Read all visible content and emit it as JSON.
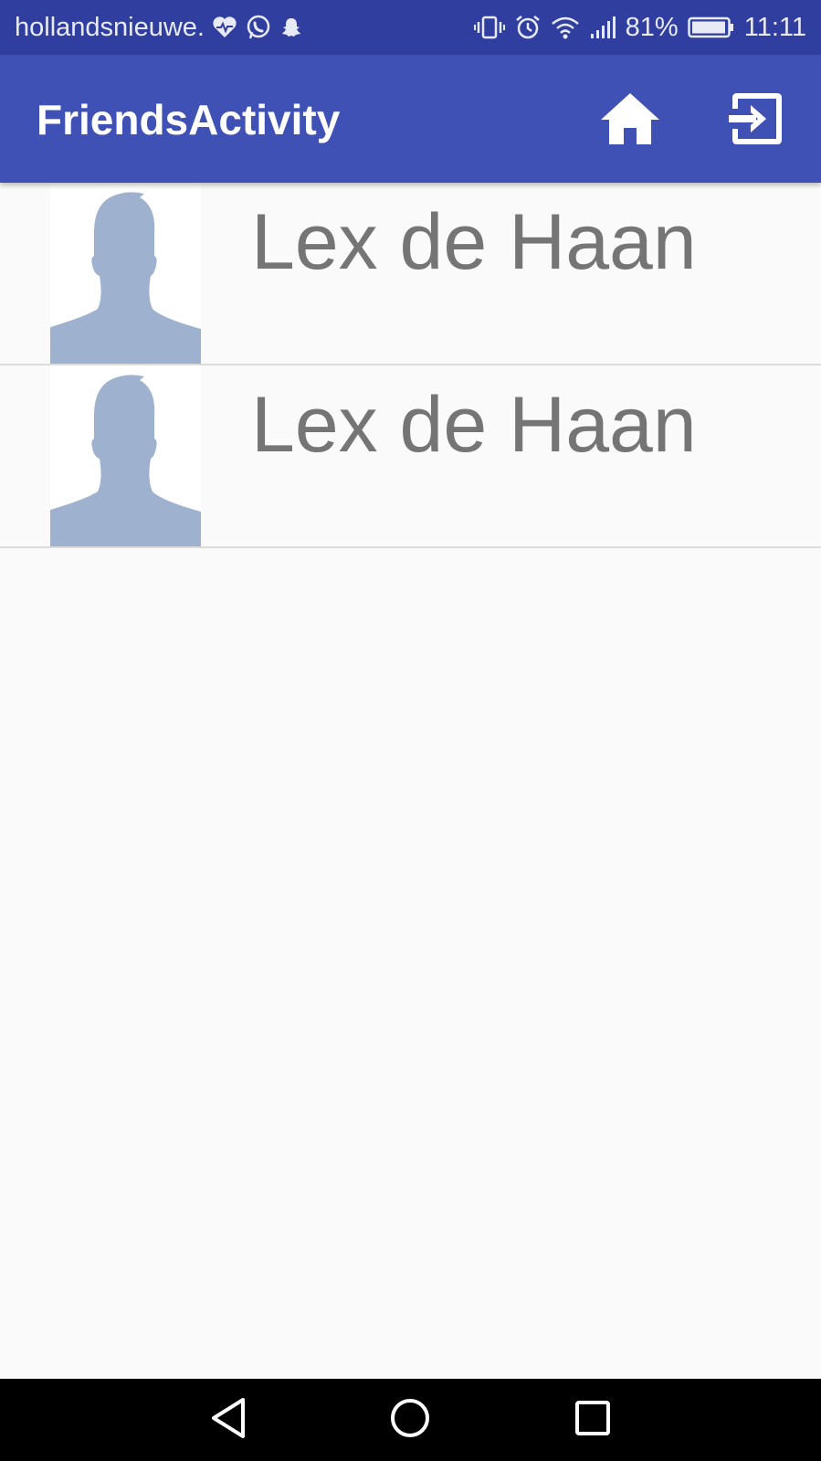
{
  "status_bar": {
    "carrier": "hollandsnieuwe.",
    "battery": "81%",
    "time": "11:11",
    "icons_left": [
      "heart-icon",
      "whatsapp-icon",
      "snapchat-icon"
    ],
    "icons_right": [
      "vibrate-icon",
      "alarm-icon",
      "wifi-icon",
      "signal-icon",
      "battery-icon"
    ]
  },
  "app_bar": {
    "title": "FriendsActivity",
    "background": "#3f51b5",
    "actions": [
      "home-icon",
      "exit-icon"
    ]
  },
  "friends": [
    {
      "name": "Lex de Haan",
      "avatar": "person-silhouette-icon"
    },
    {
      "name": "Lex de Haan",
      "avatar": "person-silhouette-icon"
    }
  ],
  "nav_bar": {
    "buttons": [
      "back-icon",
      "home-circle-icon",
      "recents-icon"
    ]
  },
  "colors": {
    "status_bar": "#303f9f",
    "app_bar": "#3f51b5",
    "avatar_silhouette": "#9eb1cf",
    "name_text": "#757575",
    "divider": "#dcdcdc"
  }
}
